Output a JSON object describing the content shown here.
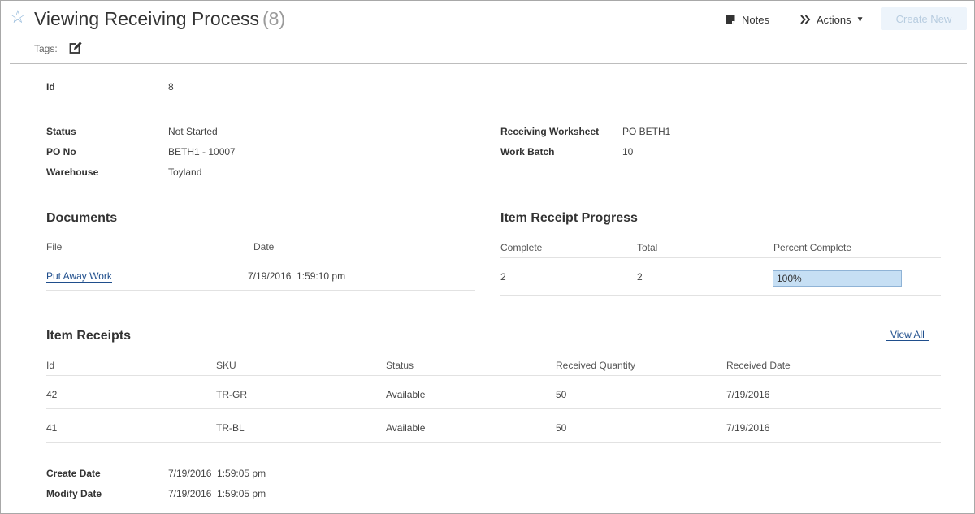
{
  "header": {
    "title": "Viewing Receiving Process",
    "count": "(8)",
    "tags_label": "Tags:",
    "notes_label": "Notes",
    "actions_label": "Actions",
    "create_new_label": "Create New"
  },
  "record": {
    "id_label": "Id",
    "id_value": "8",
    "status_label": "Status",
    "status_value": "Not Started",
    "po_no_label": "PO No",
    "po_no_value": "BETH1 - 10007",
    "warehouse_label": "Warehouse",
    "warehouse_value": "Toyland",
    "receiving_worksheet_label": "Receiving Worksheet",
    "receiving_worksheet_value": "PO BETH1",
    "work_batch_label": "Work Batch",
    "work_batch_value": "10"
  },
  "documents": {
    "title": "Documents",
    "columns": [
      "File",
      "Date"
    ],
    "rows": [
      {
        "file": "Put Away Work",
        "date": "7/19/2016  1:59:10 pm"
      }
    ]
  },
  "progress": {
    "title": "Item Receipt Progress",
    "columns": [
      "Complete",
      "Total",
      "Percent Complete"
    ],
    "complete": "2",
    "total": "2",
    "percent_label": "100%",
    "percent_fraction": 1.0
  },
  "item_receipts": {
    "title": "Item Receipts",
    "view_all_label": "View All",
    "columns": [
      "Id",
      "SKU",
      "Status",
      "Received Quantity",
      "Received Date"
    ],
    "rows": [
      {
        "id": "42",
        "sku": "TR-GR",
        "status": "Available",
        "qty": "50",
        "date": "7/19/2016"
      },
      {
        "id": "41",
        "sku": "TR-BL",
        "status": "Available",
        "qty": "50",
        "date": "7/19/2016"
      }
    ]
  },
  "footer": {
    "create_date_label": "Create Date",
    "create_date_value": "7/19/2016  1:59:05 pm",
    "modify_date_label": "Modify Date",
    "modify_date_value": "7/19/2016  1:59:05 pm"
  },
  "colors": {
    "link": "#1f4e8c",
    "star": "#8fb6d9",
    "progress_fill": "#c6dff4",
    "create_bg": "#edf4fb"
  }
}
